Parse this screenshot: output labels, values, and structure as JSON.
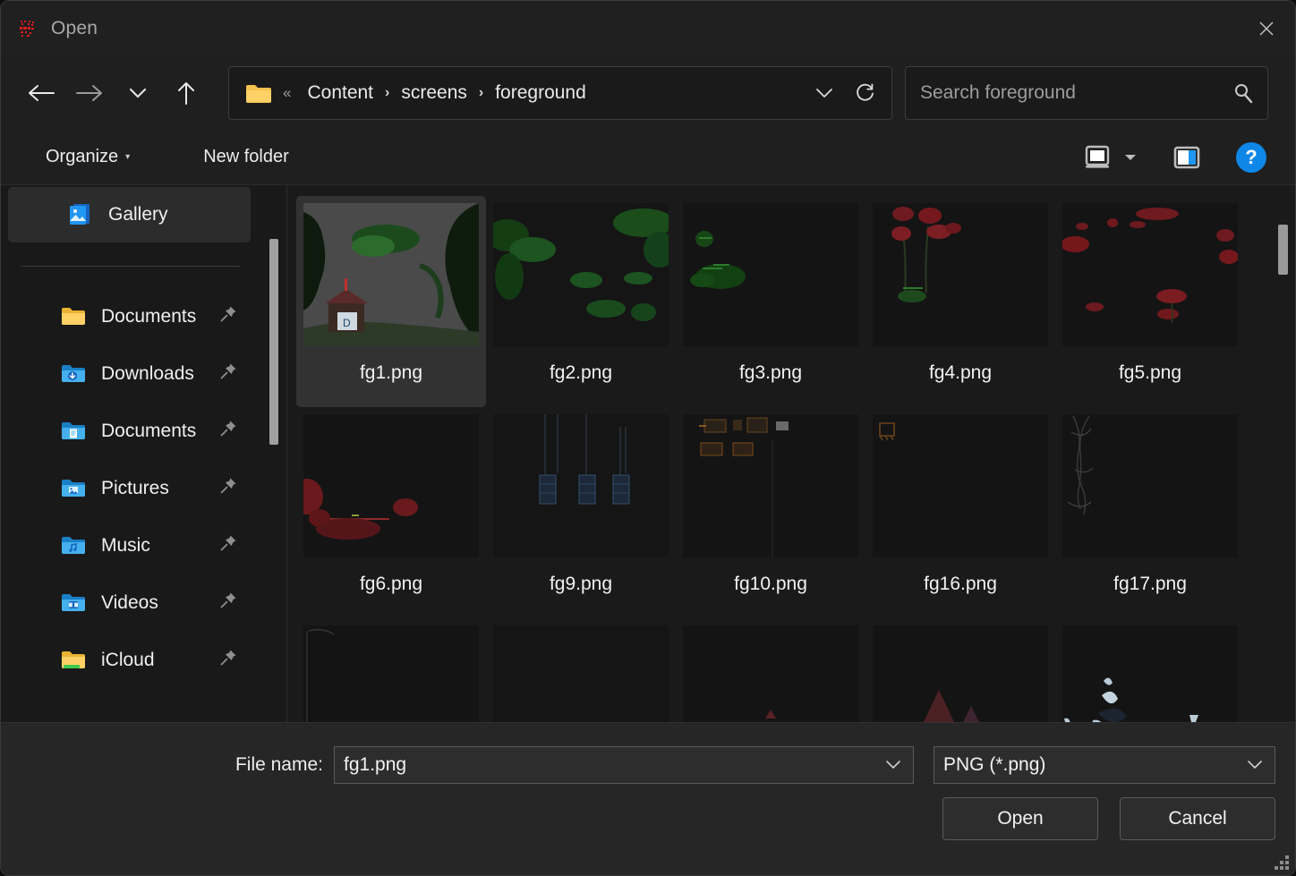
{
  "window": {
    "title": "Open",
    "app_icon": "app-logo-icon",
    "close_label": "✕"
  },
  "nav": {
    "back": "back-arrow",
    "forward": "forward-arrow",
    "recent": "chevron-down",
    "up": "up-arrow",
    "address": {
      "folder_icon": "folder-icon",
      "overflow": "«",
      "crumbs": [
        "Content",
        "screens",
        "foreground"
      ],
      "separator": "›",
      "history_icon": "chevron-down-icon",
      "refresh_icon": "refresh-icon"
    },
    "search": {
      "placeholder": "Search foreground",
      "value": "",
      "icon": "search-icon"
    }
  },
  "toolbar": {
    "organize": "Organize",
    "organize_caret": "▾",
    "new_folder": "New folder",
    "view_icon": "view-layout-icon",
    "view_caret": "▾",
    "preview_pane_icon": "preview-pane-icon",
    "help": "?"
  },
  "sidebar": {
    "gallery": {
      "label": "Gallery",
      "icon": "gallery-icon",
      "selected": true
    },
    "items": [
      {
        "label": "Documents",
        "icon": "folder-yellow-icon",
        "pinned": true
      },
      {
        "label": "Downloads",
        "icon": "folder-downloads-icon",
        "pinned": true
      },
      {
        "label": "Documents",
        "icon": "folder-documents-icon",
        "pinned": true
      },
      {
        "label": "Pictures",
        "icon": "folder-pictures-icon",
        "pinned": true
      },
      {
        "label": "Music",
        "icon": "folder-music-icon",
        "pinned": true
      },
      {
        "label": "Videos",
        "icon": "folder-videos-icon",
        "pinned": true
      },
      {
        "label": "iCloud",
        "icon": "folder-icloud-icon",
        "pinned": true
      }
    ],
    "pin_glyph": "📌"
  },
  "files": [
    {
      "name": "fg1.png",
      "selected": true,
      "art": "trees-house"
    },
    {
      "name": "fg2.png",
      "selected": false,
      "art": "foliage-green"
    },
    {
      "name": "fg3.png",
      "selected": false,
      "art": "bush-green"
    },
    {
      "name": "fg4.png",
      "selected": false,
      "art": "flowers-red"
    },
    {
      "name": "fg5.png",
      "selected": false,
      "art": "blossom-red"
    },
    {
      "name": "fg6.png",
      "selected": false,
      "art": "rocks-red"
    },
    {
      "name": "fg9.png",
      "selected": false,
      "art": "lanterns-blue"
    },
    {
      "name": "fg10.png",
      "selected": false,
      "art": "stalls-orange"
    },
    {
      "name": "fg16.png",
      "selected": false,
      "art": "frame-orange"
    },
    {
      "name": "fg17.png",
      "selected": false,
      "art": "vines-gray"
    }
  ],
  "footer": {
    "file_name_label": "File name:",
    "file_name_value": "fg1.png",
    "file_type_value": "PNG (*.png)",
    "combo_caret": "⌄",
    "open_label": "Open",
    "cancel_label": "Cancel"
  },
  "colors": {
    "window_bg": "#1f1f1f",
    "titlebar_bg": "#202020",
    "sidebar_bg": "#191919",
    "filearea_bg": "#1a1a1a",
    "footer_bg": "#262626",
    "selection": "#323232",
    "accent_blue": "#0f87e8",
    "text": "#f0f0f0",
    "muted_text": "#9d9d9d",
    "scrollbar": "#9a9a9a"
  }
}
